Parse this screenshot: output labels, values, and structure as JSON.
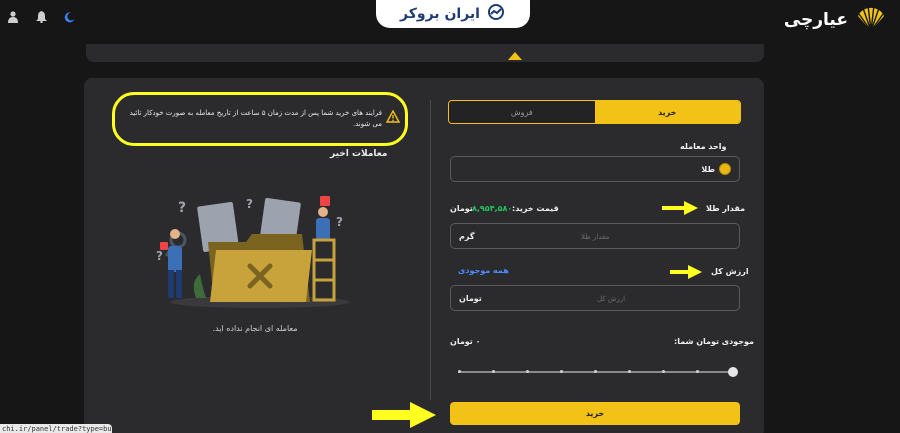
{
  "header": {
    "brand_name": "عیارچی",
    "watermark": "ایران بروکر",
    "icons": [
      "user-icon",
      "bell-icon",
      "moon-icon"
    ]
  },
  "trade": {
    "tabs": [
      {
        "label": "خرید",
        "active": true
      },
      {
        "label": "فروش",
        "active": false
      }
    ],
    "unit_label": "واحد معامله",
    "unit_value": "طلا",
    "amount_label": "مقدار طلا",
    "buy_price_label": "قیمت خرید:",
    "buy_price_value": "۸,۹۵۴,۵۸۰",
    "buy_price_unit": "تومان",
    "amount_placeholder": "مقدار طلا",
    "amount_unit": "گرم",
    "total_label": "ارزش کل",
    "all_balance_link": "همه موجودی",
    "total_placeholder": "ارزش کل",
    "total_unit": "تومان",
    "balance_label": "موجودی تومان شما:",
    "balance_value": "۰ تومان",
    "slider_percent": 100,
    "buy_button": "خرید"
  },
  "recent": {
    "warning_text": "فرایند های خرید شما پس از مدت زمان ۵ ساعت از تاریخ معامله به صورت خودکار تائید می شوند.",
    "title": "معاملات اخیر",
    "empty_text": "معامله ای انجام نداده اید."
  },
  "status_bar": {
    "url": "chi.ir/panel/trade?type=buy"
  },
  "colors": {
    "accent": "#f2c316",
    "card": "#2b2b2d",
    "background": "#161616",
    "highlight": "#ffff20",
    "link": "#4c8dff",
    "price": "#22c55e"
  }
}
